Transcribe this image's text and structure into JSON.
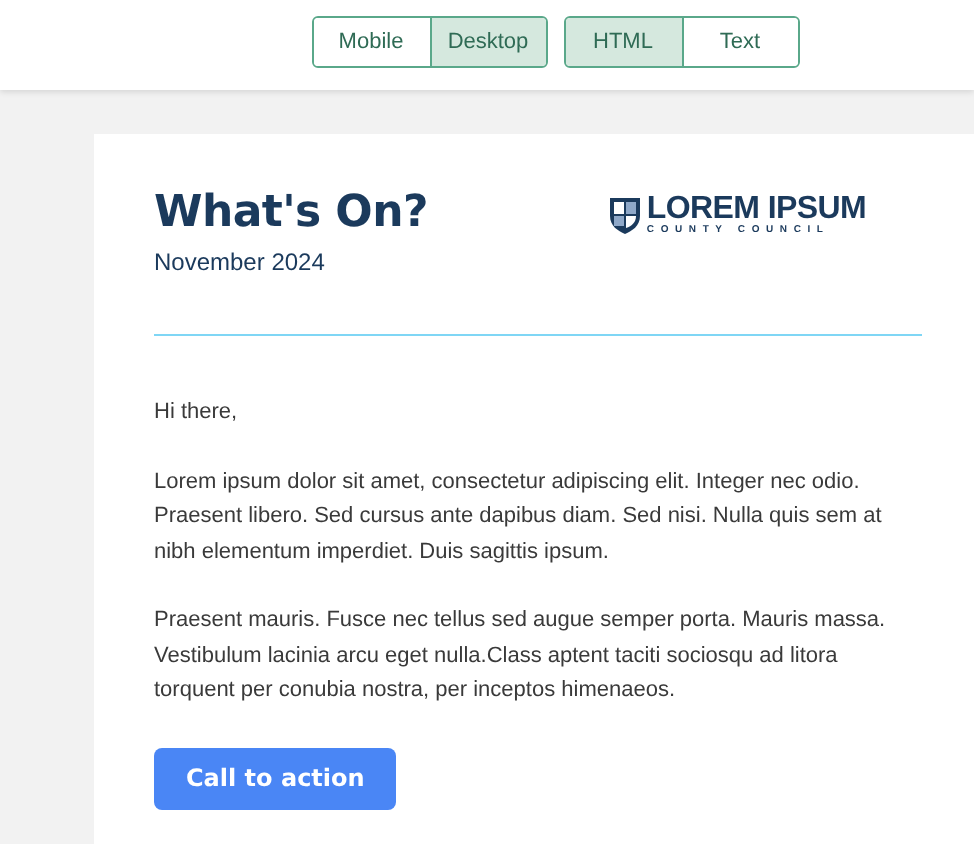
{
  "view_toggle": [
    {
      "label": "Mobile",
      "selected": false
    },
    {
      "label": "Desktop",
      "selected": true
    }
  ],
  "format_toggle": [
    {
      "label": "HTML",
      "selected": true
    },
    {
      "label": "Text",
      "selected": false
    }
  ],
  "email": {
    "title": "What's On?",
    "date": "November 2024",
    "logo": {
      "name": "LOREM IPSUM",
      "subtitle": "COUNTY COUNCIL"
    },
    "greeting": "Hi there,",
    "paragraphs": [
      "Lorem ipsum dolor sit amet, consectetur adipiscing elit. Integer nec odio. Praesent libero. Sed cursus ante dapibus diam. Sed nisi. Nulla quis sem at nibh elementum imperdiet. Duis sagittis ipsum.",
      "Praesent mauris. Fusce nec tellus sed augue semper porta. Mauris massa. Vestibulum lacinia arcu eget nulla.Class aptent taciti sociosqu ad litora torquent per conubia nostra, per inceptos himenaeos."
    ],
    "button": "Call to action"
  }
}
